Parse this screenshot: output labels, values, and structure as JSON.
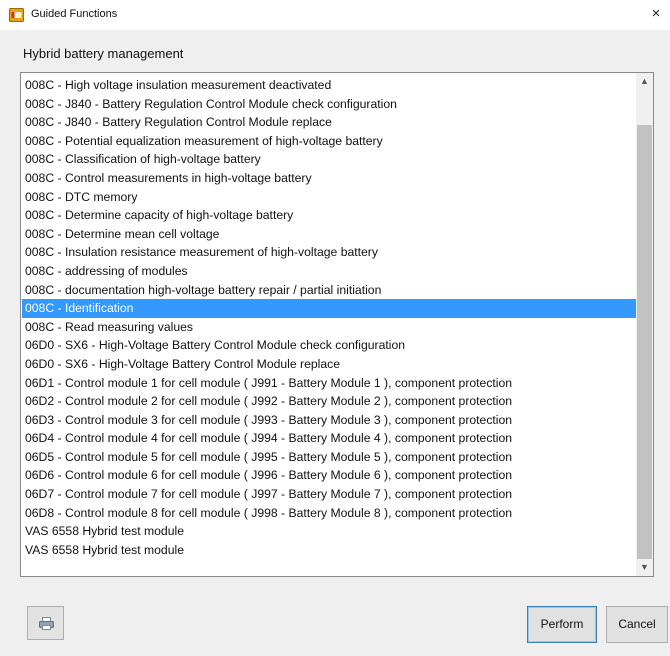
{
  "window": {
    "title": "Guided Functions",
    "close_label": "×"
  },
  "section": {
    "label": "Hybrid battery management"
  },
  "list": {
    "selected_index": 12,
    "items": [
      "008C  -  High voltage insulation measurement  deactivated",
      "008C  -  J840 - Battery Regulation Control Module  check configuration",
      "008C  -  J840 - Battery Regulation Control Module  replace",
      "008C  -  Potential equalization measurement  of high-voltage battery",
      "008C  - Classification of high-voltage battery",
      "008C  - Control measurements in high-voltage battery",
      "008C  - DTC memory",
      "008C  - Determine capacity of high-voltage battery",
      "008C  - Determine mean cell voltage",
      "008C  - Insulation resistance measurement of high-voltage battery",
      "008C  - addressing of modules",
      "008C  - documentation high-voltage battery repair / partial initiation",
      "008C - Identification",
      "008C - Read measuring values",
      "06D0  -  SX6 - High-Voltage Battery Control Module  check configuration",
      "06D0  -  SX6 - High-Voltage Battery Control Module  replace",
      "06D1 - Control module 1 for cell module  ( J991 - Battery Module 1 ), component protection",
      "06D2 - Control module 2 for cell module  ( J992 - Battery Module 2 ), component protection",
      "06D3 - Control module 3 for cell module  ( J993 - Battery Module 3 ), component protection",
      "06D4 - Control module 4 for cell module  ( J994 - Battery Module 4 ), component protection",
      "06D5 - Control module 5 for cell module  ( J995 - Battery Module 5 ), component protection",
      "06D6 - Control module 6 for cell module  ( J996 - Battery Module 6 ), component protection",
      "06D7 - Control module 7 for cell module  ( J997 - Battery Module 7 ), component protection",
      "06D8 - Control module 8 for cell module  ( J998 - Battery Module 8 ), component protection",
      "VAS 6558 Hybrid test module",
      "VAS 6558 Hybrid test module"
    ]
  },
  "scrollbar": {
    "up_glyph": "▲",
    "down_glyph": "▼"
  },
  "buttons": {
    "perform_label": "Perform",
    "cancel_label": "Cancel"
  },
  "colors": {
    "selection": "#3399ff",
    "app_icon": "#e8a21a"
  }
}
